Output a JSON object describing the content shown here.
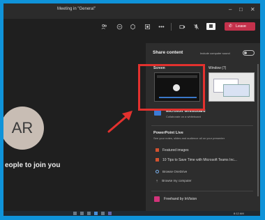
{
  "window": {
    "title": "Meeting in \"General\"",
    "controls": [
      "–",
      "□",
      "✕"
    ]
  },
  "toolbar": {
    "icons": [
      "people-icon",
      "chat-icon",
      "reactions-icon",
      "rooms-icon",
      "more-icon",
      "camera-icon",
      "mic-icon",
      "share-icon"
    ],
    "leave_label": "Leave"
  },
  "meeting": {
    "avatar_initials": "AR",
    "invite_text": "eople to join you"
  },
  "share_panel": {
    "title": "Share content",
    "include_sound_label": "Include computer sound",
    "screen_label": "Screen",
    "window_label": "Window (7)",
    "whiteboard_title": "Microsoft Whiteboard",
    "whiteboard_subtitle": "Collaborate on a whiteboard",
    "powerpoint_title": "PowerPoint Live",
    "powerpoint_subtitle": "See your notes, slides and audience all on your presenter",
    "files": [
      "Featured images",
      "10 Tips to Save Time with Microsoft Teams Inc..."
    ],
    "browse_onedrive": "Browse OneDrive",
    "browse_computer": "Browse my computer",
    "freehand_label": "Freehand by InVision"
  },
  "annotation": {
    "highlight_color": "#e3312e"
  },
  "taskbar": {
    "clock": "8:12 AM"
  }
}
